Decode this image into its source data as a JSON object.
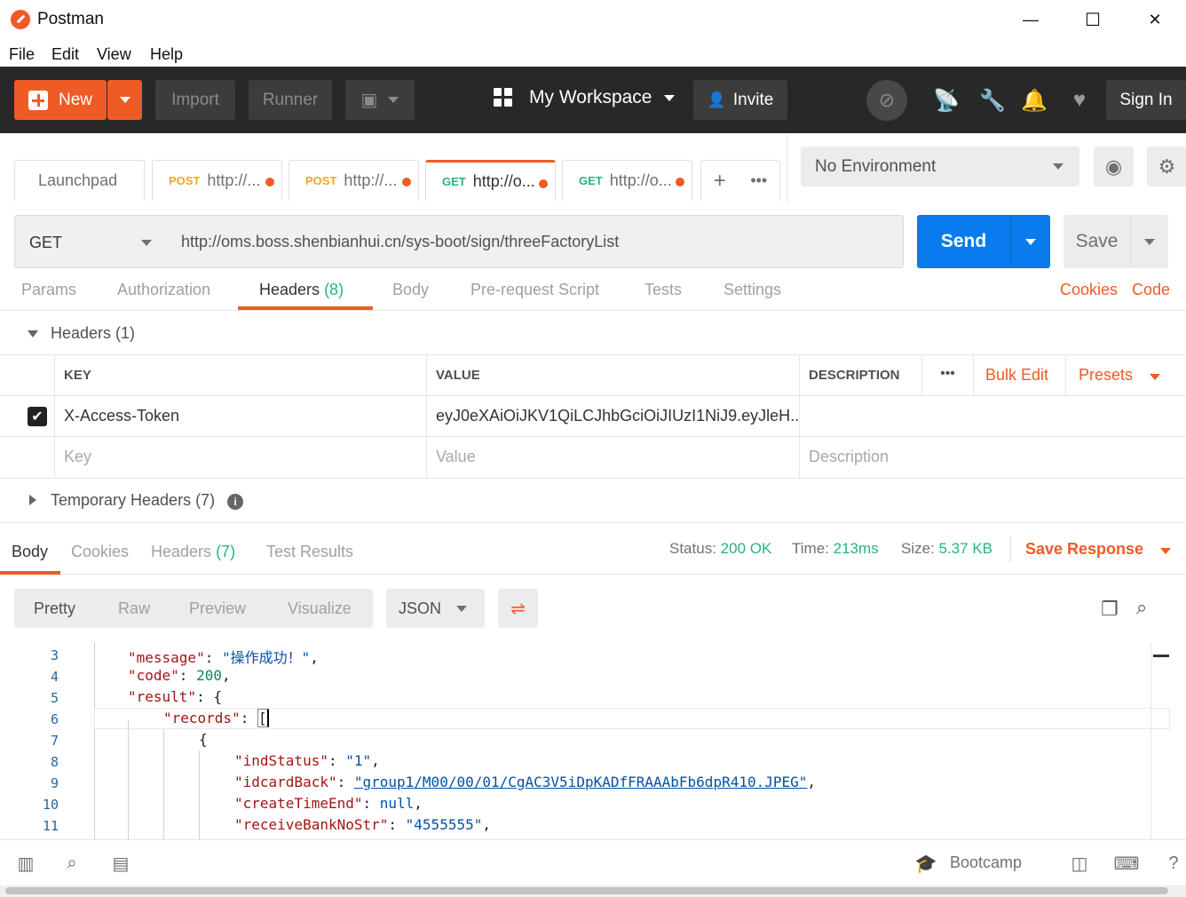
{
  "window": {
    "title": "Postman",
    "minimize": "—",
    "maximize": "☐",
    "close": "✕"
  },
  "menu": [
    "File",
    "Edit",
    "View",
    "Help"
  ],
  "header": {
    "new_label": "New",
    "import_label": "Import",
    "runner_label": "Runner",
    "workspace_label": "My Workspace",
    "invite_label": "Invite",
    "signin_label": "Sign In"
  },
  "tabs": [
    {
      "label": "Launchpad",
      "method": "",
      "dirty": false
    },
    {
      "label": "http://...",
      "method": "POST",
      "dirty": true
    },
    {
      "label": "http://...",
      "method": "POST",
      "dirty": true
    },
    {
      "label": "http://o...",
      "method": "GET",
      "dirty": true,
      "active": true
    },
    {
      "label": "http://o...",
      "method": "GET",
      "dirty": true
    }
  ],
  "environment": {
    "selected": "No Environment"
  },
  "request": {
    "method": "GET",
    "url": "http://oms.boss.shenbianhui.cn/sys-boot/sign/threeFactoryList",
    "send_label": "Send",
    "save_label": "Save"
  },
  "request_tabs": {
    "params": "Params",
    "authorization": "Authorization",
    "headers": "Headers",
    "headers_count": "(8)",
    "body": "Body",
    "prerequest": "Pre-request Script",
    "tests": "Tests",
    "settings": "Settings",
    "cookies": "Cookies",
    "code": "Code"
  },
  "headers_section": {
    "title": "Headers (1)",
    "columns": {
      "key": "KEY",
      "value": "VALUE",
      "description": "DESCRIPTION"
    },
    "bulk_edit": "Bulk Edit",
    "presets": "Presets",
    "rows": [
      {
        "checked": true,
        "key": "X-Access-Token",
        "value": "eyJ0eXAiOiJKV1QiLCJhbGciOiJIUzI1NiJ9.eyJleH...",
        "description": ""
      }
    ],
    "placeholder": {
      "key": "Key",
      "value": "Value",
      "description": "Description"
    },
    "temporary": "Temporary Headers (7)"
  },
  "response_tabs": {
    "body": "Body",
    "cookies": "Cookies",
    "headers": "Headers",
    "headers_count": "(7)",
    "test_results": "Test Results",
    "status_label": "Status:",
    "status_value": "200 OK",
    "time_label": "Time:",
    "time_value": "213ms",
    "size_label": "Size:",
    "size_value": "5.37 KB",
    "save_response": "Save Response"
  },
  "response_toolbar": {
    "modes": [
      "Pretty",
      "Raw",
      "Preview",
      "Visualize"
    ],
    "format": "JSON"
  },
  "code_lines": [
    {
      "n": "3",
      "key": "\"message\"",
      "val": "\"操作成功！\"",
      "vtype": "s",
      "tail": ","
    },
    {
      "n": "4",
      "key": "\"code\"",
      "val": "200",
      "vtype": "n",
      "tail": ","
    },
    {
      "n": "5",
      "key": "\"result\"",
      "val": "",
      "vtype": "p",
      "tail": "{"
    },
    {
      "n": "6",
      "key": "\"records\"",
      "val": "",
      "vtype": "p",
      "tail": "["
    },
    {
      "n": "7",
      "key": "",
      "val": "",
      "vtype": "p",
      "tail": "{"
    },
    {
      "n": "8",
      "key": "\"indStatus\"",
      "val": "\"1\"",
      "vtype": "s",
      "tail": ","
    },
    {
      "n": "9",
      "key": "\"idcardBack\"",
      "val": "\"group1/M00/00/01/CgAC3V5iDpKADfFRAAAbFb6dpR410.JPEG\"",
      "vtype": "s",
      "tail": ","
    },
    {
      "n": "10",
      "key": "\"createTimeEnd\"",
      "val": "null",
      "vtype": "s",
      "tail": ","
    },
    {
      "n": "11",
      "key": "\"receiveBankNoStr\"",
      "val": "\"4555555\"",
      "vtype": "s",
      "tail": ","
    }
  ],
  "statusbar": {
    "bootcamp": "Bootcamp"
  },
  "colors": {
    "brand": "#ef5b25",
    "send": "#097bed",
    "success": "#26b47f",
    "header_bg": "#282828"
  }
}
